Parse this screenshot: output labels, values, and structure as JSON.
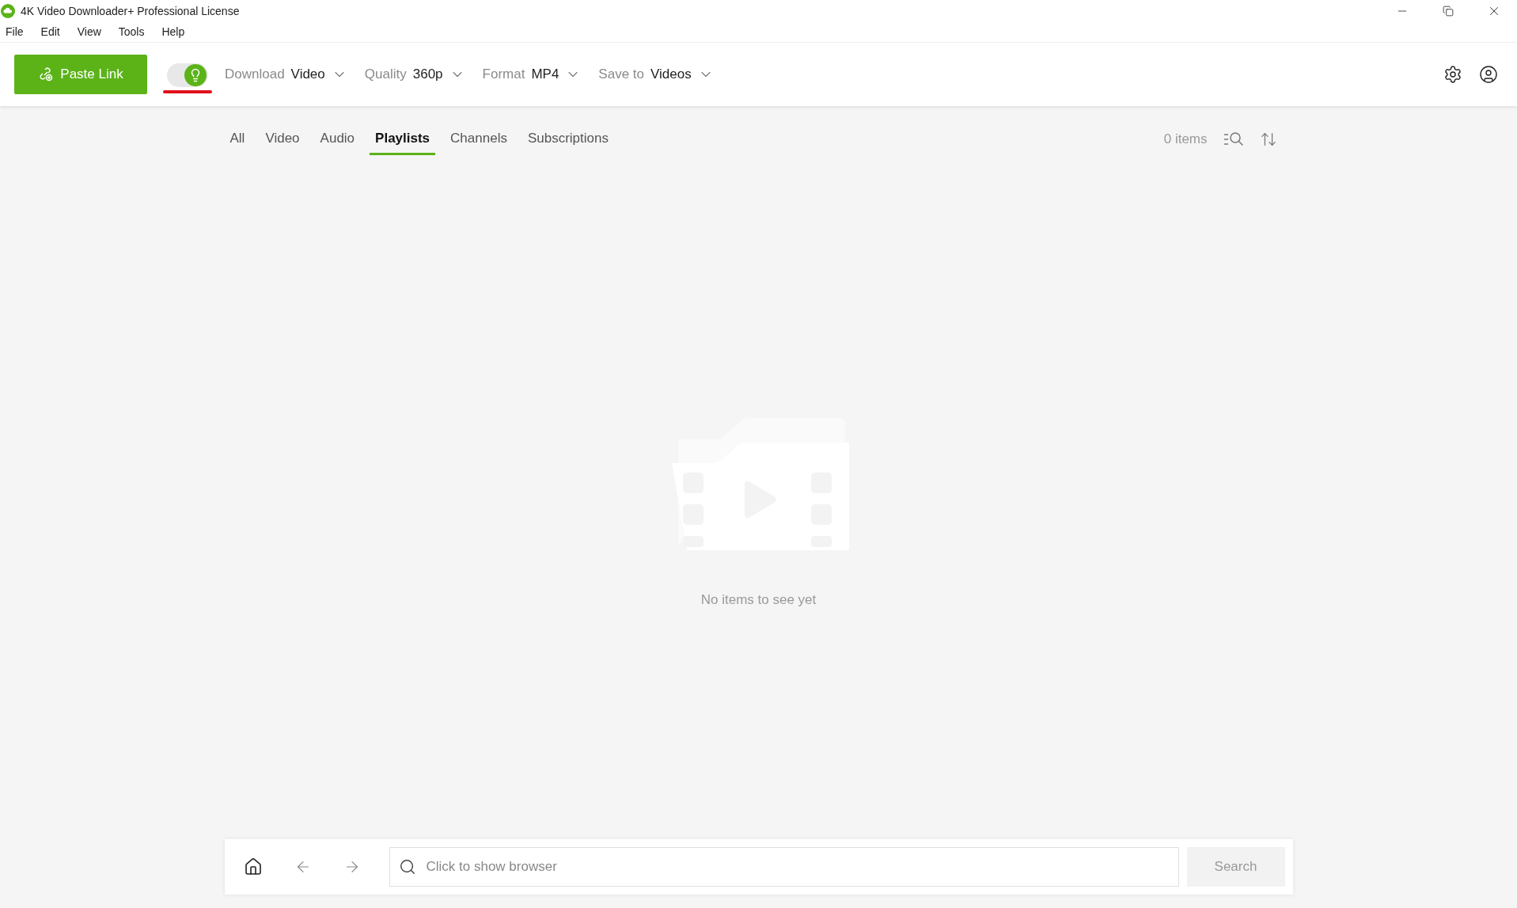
{
  "window": {
    "title": "4K Video Downloader+ Professional License"
  },
  "menu": [
    "File",
    "Edit",
    "View",
    "Tools",
    "Help"
  ],
  "toolbar": {
    "paste_button": "Paste Link",
    "smart_mode": {
      "on": true
    },
    "options": [
      {
        "label": "Download",
        "value": "Video"
      },
      {
        "label": "Quality",
        "value": "360p"
      },
      {
        "label": "Format",
        "value": "MP4"
      },
      {
        "label": "Save to",
        "value": "Videos"
      }
    ]
  },
  "tabs": [
    {
      "label": "All",
      "selected": false
    },
    {
      "label": "Video",
      "selected": false
    },
    {
      "label": "Audio",
      "selected": false
    },
    {
      "label": "Playlists",
      "selected": true
    },
    {
      "label": "Channels",
      "selected": false
    },
    {
      "label": "Subscriptions",
      "selected": false
    }
  ],
  "item_count": "0 items",
  "empty_message": "No items to see yet",
  "browser_bar": {
    "placeholder": "Click to show browser",
    "search_button": "Search"
  }
}
